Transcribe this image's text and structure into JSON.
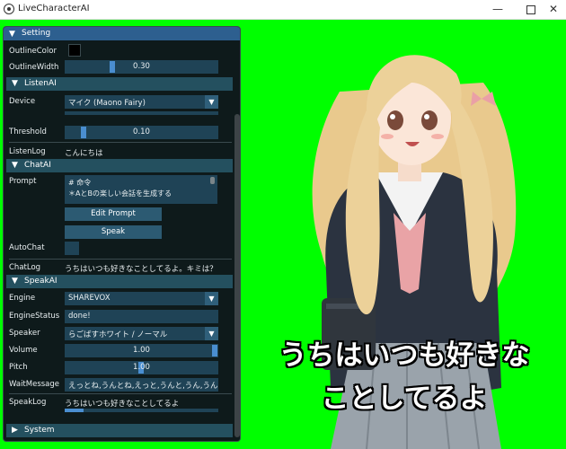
{
  "window": {
    "title": "LiveCharacterAI",
    "minimize": "—",
    "close": "✕"
  },
  "panel": {
    "title": "Setting"
  },
  "outline": {
    "color_label": "OutlineColor",
    "color_value": "#000000",
    "width_label": "OutlineWidth",
    "width_value": "0.30",
    "width_fraction": 0.3
  },
  "listen": {
    "header": "ListenAI",
    "device_label": "Device",
    "device_value": "マイク (Maono Fairy)",
    "threshold_label": "Threshold",
    "threshold_value": "0.10",
    "threshold_fraction": 0.1,
    "log_label": "ListenLog",
    "log_value": "こんにちは"
  },
  "chat": {
    "header": "ChatAI",
    "prompt_label": "Prompt",
    "prompt_line1": "# 命令",
    "prompt_line2": "＊AとBの楽しい会話を生成する",
    "edit_prompt": "Edit Prompt",
    "speak_button": "Speak",
    "autochat_label": "AutoChat",
    "log_label": "ChatLog",
    "log_value": "うちはいつも好きなことしてるよ。キミは？"
  },
  "speak": {
    "header": "SpeakAI",
    "engine_label": "Engine",
    "engine_value": "SHAREVOX",
    "status_label": "EngineStatus",
    "status_value": "done!",
    "speaker_label": "Speaker",
    "speaker_value": "らごばすホワイト / ノーマル",
    "volume_label": "Volume",
    "volume_value": "1.00",
    "volume_fraction": 1.0,
    "pitch_label": "Pitch",
    "pitch_value": "1.00",
    "pitch_fraction": 0.5,
    "wait_label": "WaitMessage",
    "wait_value": "えっとね,うんとね,えっと,うんと,うん,うんうん",
    "log_label": "SpeakLog",
    "log_value": "うちはいつも好きなことしてるよ",
    "log_progress": 0.12
  },
  "system": {
    "header": "System"
  },
  "subtitle": {
    "line1": "うちはいつも好きな",
    "line2": "ことしてるよ"
  },
  "colors": {
    "background": "#00ff00",
    "panel_bg": "#0e1a1b",
    "header": "#24505f",
    "title": "#2d5f8f",
    "field": "#1f4356",
    "grab": "#4a8ed0"
  }
}
